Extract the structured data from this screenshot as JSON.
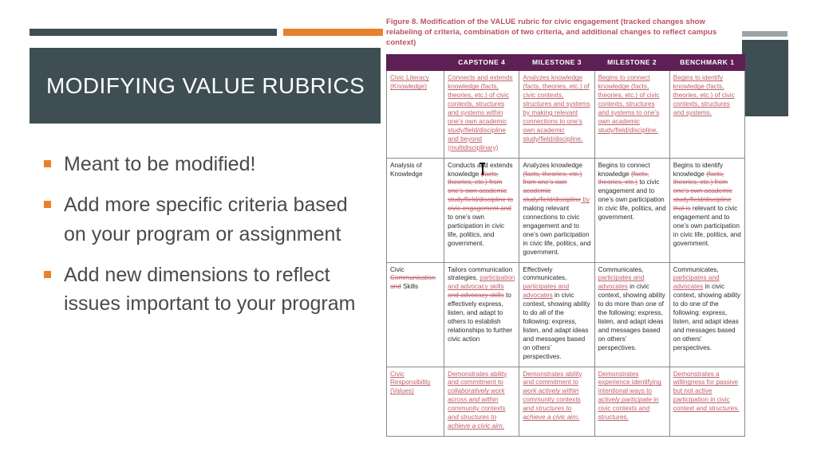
{
  "slide": {
    "title": "MODIFYING VALUE RUBRICS",
    "accent_orange": "#e8812c",
    "accent_dark": "#3f4e52",
    "bullets": [
      "Meant to be modified!",
      "Add more specific criteria based on your program or assignment",
      "Add new dimensions to reflect issues important to your program"
    ]
  },
  "figure": {
    "caption": "Figure 8. Modification of the VALUE rubric for civic engagement (tracked changes show relabeling of criteria, combination of two criteria, and additional changes to reflect campus context)",
    "caption_color": "#b9515c",
    "header_color": "#5e1f55",
    "columns": [
      "",
      "CAPSTONE 4",
      "MILESTONE 3",
      "MILESTONE 2",
      "BENCHMARK 1"
    ],
    "rows": [
      {
        "criterion": [
          {
            "t": "Civic Literacy (Knowledge)",
            "s": "ins"
          }
        ],
        "cells": [
          [
            {
              "t": "Connects and extends knowledge (facts, theories, etc.) of civic contexts, structures and systems within one’s own academic study/field/discipline and beyond (multidisciplinary)",
              "s": "ins"
            }
          ],
          [
            {
              "t": "Analyzes knowledge (facts, theories, etc.) of civic contexts, structures and systems by making relevant connections to one’s own academic study/field/discipline.",
              "s": "ins"
            }
          ],
          [
            {
              "t": "Begins to connect knowledge (facts, theories, etc.) of civic contexts, structures and systems to one’s own academic study/field/discipline.",
              "s": "ins"
            }
          ],
          [
            {
              "t": "Begins to identify knowledge (facts, theories, etc.) of civic contexts, structures and systems.",
              "s": "ins"
            }
          ]
        ]
      },
      {
        "criterion": [
          {
            "t": "Analysis of Knowledge",
            "s": "plain"
          }
        ],
        "cells": [
          [
            {
              "t": "Conducts and extends knowledge ",
              "s": "plain"
            },
            {
              "t": "(facts, theories, etc.) from one’s own academic study/field/discipline to civic engagement and",
              "s": "del"
            },
            {
              "t": " to one’s own  participation in civic life, politics, and government.",
              "s": "plain"
            }
          ],
          [
            {
              "t": "Analyzes knowledge ",
              "s": "plain"
            },
            {
              "t": "(facts, theories, etc.) from one’s own academic study/field/discipline",
              "s": "del"
            },
            {
              "t": " by",
              "s": "ins"
            },
            {
              "t": " making relevant connections to civic engagement and to one’s own participation in civic life, politics, and government.",
              "s": "plain"
            }
          ],
          [
            {
              "t": "Begins to connect knowledge ",
              "s": "plain"
            },
            {
              "t": "(facts, theories, etc.)",
              "s": "del"
            },
            {
              "t": " to civic engagement and to one’s own participation in civic life, politics, and government.",
              "s": "plain"
            }
          ],
          [
            {
              "t": "Begins to identify knowledge ",
              "s": "plain"
            },
            {
              "t": "(facts, theories, etc.) from one’s own academic study/field/discipline that is",
              "s": "del"
            },
            {
              "t": " relevant to civic engagement and to one’s own participation in civic life, politics, and government.",
              "s": "plain"
            }
          ]
        ]
      },
      {
        "criterion": [
          {
            "t": "Civic ",
            "s": "plain"
          },
          {
            "t": "Communication and",
            "s": "del"
          },
          {
            "t": " Skills",
            "s": "plain"
          }
        ],
        "cells": [
          [
            {
              "t": "Tailors communication strategies, ",
              "s": "plain"
            },
            {
              "t": "participation and advocacy skills",
              "s": "ins"
            },
            {
              "t": " and advocacy skills",
              "s": "del"
            },
            {
              "t": " to effectively express, listen, and adapt to others to establish relationships to further civic action",
              "s": "plain"
            }
          ],
          [
            {
              "t": "Effectively communicates, ",
              "s": "plain"
            },
            {
              "t": "participates and advocates",
              "s": "ins"
            },
            {
              "t": " in civic context, showing ability to do all of the following: express, listen, and adapt ideas and messages based on others’ perspectives.",
              "s": "plain"
            }
          ],
          [
            {
              "t": "Communicates, ",
              "s": "plain"
            },
            {
              "t": "participates and advocates",
              "s": "ins"
            },
            {
              "t": " in civic context, showing ability to do more than one of the following:  express, listen, and adapt ideas and messages based on others’ perspectives.",
              "s": "plain"
            }
          ],
          [
            {
              "t": "Communicates, ",
              "s": "plain"
            },
            {
              "t": "participates and advocates",
              "s": "ins"
            },
            {
              "t": " in civic context, showing ability to do one of the following: express, listen, and adapt ideas and messages based on others’ perspectives.",
              "s": "plain"
            }
          ]
        ]
      },
      {
        "criterion": [
          {
            "t": "Civic Responsibility (Values)",
            "s": "ins"
          }
        ],
        "cells": [
          [
            {
              "t": "Demonstrates ability and commitment to ",
              "s": "ins"
            },
            {
              "t": "collaboratively work across and within",
              "s": "ins-i"
            },
            {
              "t": " community contexts ",
              "s": "ins"
            },
            {
              "t": "and structures to achieve a civic aim.",
              "s": "ins-i"
            }
          ],
          [
            {
              "t": "Demonstrates ability and commitment to ",
              "s": "ins"
            },
            {
              "t": "work actively within",
              "s": "ins-i"
            },
            {
              "t": " community contexts ",
              "s": "ins"
            },
            {
              "t": "and structures to achieve a civic aim.",
              "s": "ins-i"
            }
          ],
          [
            {
              "t": "Demonstrates experience identifying intentional ways to ",
              "s": "ins"
            },
            {
              "t": "actively participate",
              "s": "ins-i"
            },
            {
              "t": " in civic contexts and structures.",
              "s": "ins"
            }
          ],
          [
            {
              "t": "Demonstrates a willingness for passive but not active participation in civic context and structures.",
              "s": "ins"
            }
          ]
        ]
      }
    ]
  }
}
